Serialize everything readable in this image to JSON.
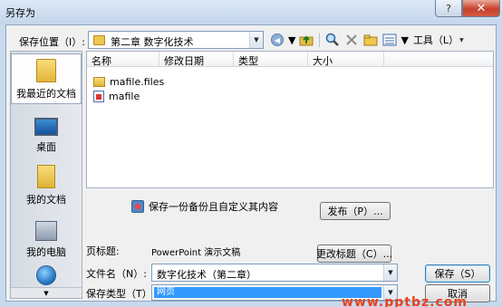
{
  "window": {
    "title": "另存为",
    "help_glyph": "?",
    "close_glyph": "✕"
  },
  "location": {
    "label": "保存位置（I）:",
    "value": "第二章  数字化技术"
  },
  "toolbar": {
    "tools_label": "工具（L）"
  },
  "places": [
    {
      "label": "我最近的文档",
      "icon": "recent-folder-icon"
    },
    {
      "label": "桌面",
      "icon": "desktop-icon"
    },
    {
      "label": "我的文档",
      "icon": "my-documents-icon"
    },
    {
      "label": "我的电脑",
      "icon": "my-computer-icon"
    },
    {
      "label": "",
      "icon": "network-icon"
    }
  ],
  "file_list": {
    "columns": [
      "名称",
      "修改日期",
      "类型",
      "大小"
    ],
    "files": [
      {
        "name": "mafile.files",
        "icon": "folder-icon"
      },
      {
        "name": "mafile",
        "icon": "web-document-icon"
      }
    ]
  },
  "backup_note": "保存一份备份且自定义其内容",
  "buttons": {
    "publish": "发布（P）...",
    "change_title": "更改标题（C）...",
    "save": "保存（S）",
    "cancel": "取消"
  },
  "page_title": {
    "label": "页标题:",
    "value": "PowerPoint 演示文稿"
  },
  "file_name": {
    "label": "文件名（N）:",
    "value": "数字化技术（第二章）"
  },
  "save_type": {
    "label": "保存类型（T）:",
    "value": "网页"
  },
  "watermark": "www.pptbz.com"
}
